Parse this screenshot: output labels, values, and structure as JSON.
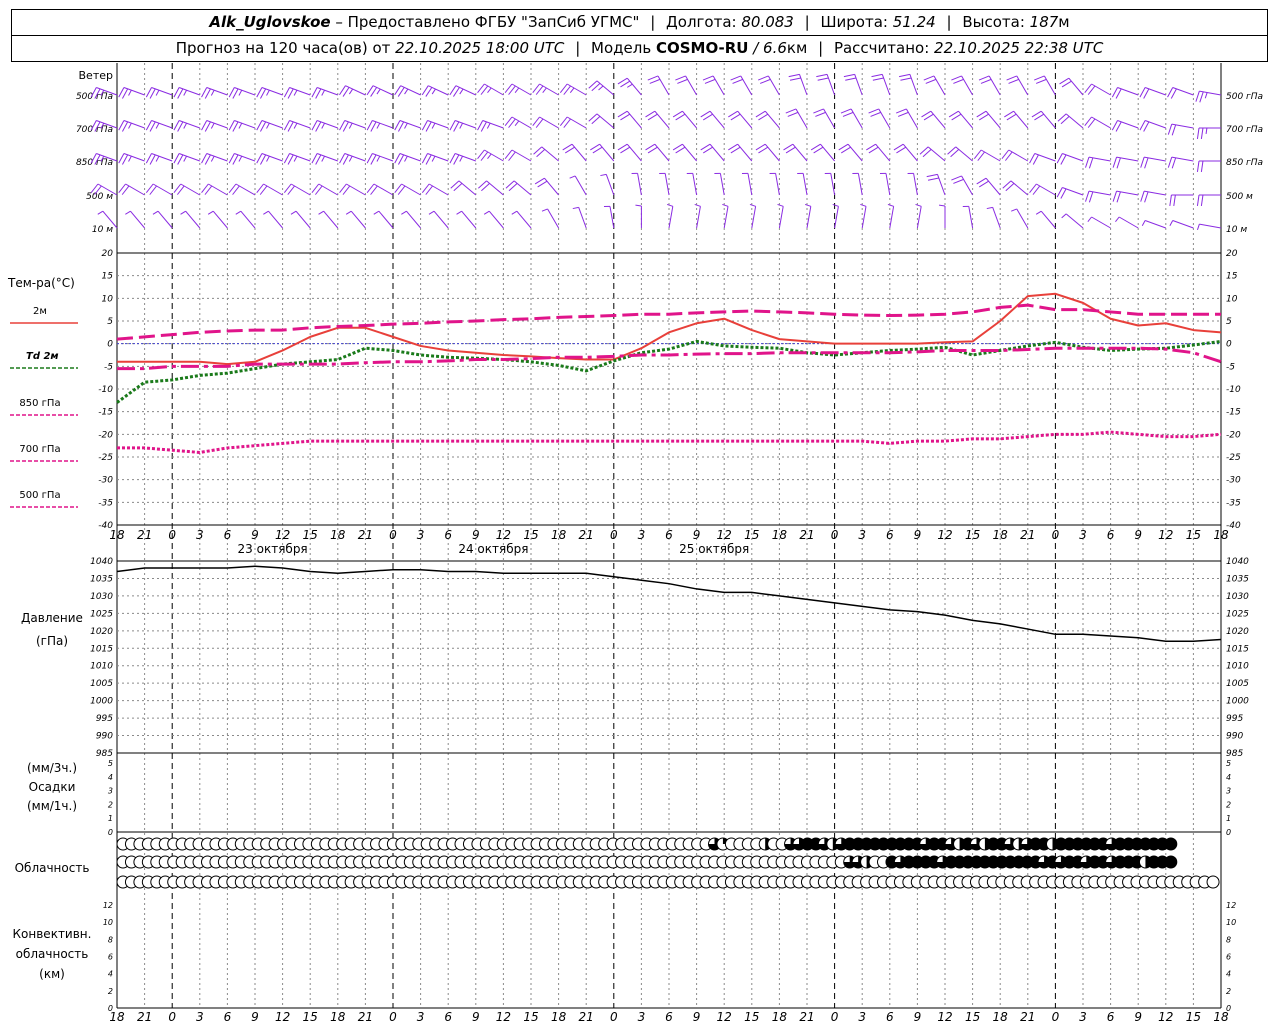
{
  "header": {
    "station": "Alk_Uglovskoe",
    "provider": "– Предоставлено ФГБУ \"ЗапСиб УГМС\"",
    "lon_label": "Долгота:",
    "lon_value": "80.083",
    "lat_label": "Широта:",
    "lat_value": "51.24",
    "alt_label": "Высота:",
    "alt_value": "187",
    "alt_unit": "м",
    "forecast_label": "Прогноз на 120 часа(ов) от",
    "forecast_start": "22.10.2025 18:00 UTC",
    "model_label": "Модель",
    "model_name": "COSMO-RU",
    "model_res": "/ 6.6",
    "model_unit": "км",
    "calc_label": "Рассчитано:",
    "calc_time": "22.10.2025 22:38 UTC"
  },
  "labels": {
    "wind": "Ветер",
    "wind_levels": [
      "500 гПа",
      "700 гПа",
      "850 гПа",
      "500 м",
      "10 м"
    ],
    "temp_title": "Тем-ра(°C)",
    "legend": [
      "2м",
      "Td 2м",
      "850 гПа",
      "700 гПа",
      "500 гПа"
    ],
    "pressure": [
      "Давление",
      "(гПа)"
    ],
    "precip": [
      "(мм/3ч.)",
      "Осадки",
      "(мм/1ч.)"
    ],
    "cloud": "Облачность",
    "conv": [
      "Конвективн.",
      "облачность",
      "(км)"
    ],
    "days": [
      "23 октября",
      "24 октября",
      "25 октября"
    ]
  },
  "colors": {
    "t2m": "#e8403a",
    "td2m": "#1a7a1a",
    "t850": "#e0148a",
    "t700": "#e0148a",
    "t500": "#e0148a",
    "wind": "#8a2be2",
    "pressure": "#000000",
    "zero_line": "#4040d0"
  },
  "chart_data": [
    {
      "type": "line",
      "title": "Тем-ра(°C)",
      "x_hours": [
        0,
        3,
        6,
        9,
        12,
        15,
        18,
        21,
        24,
        27,
        30,
        33,
        36,
        39,
        42,
        45,
        48,
        51,
        54,
        57,
        60,
        63,
        66,
        69,
        72,
        75,
        78,
        81,
        84,
        87,
        90,
        93,
        96,
        99,
        102,
        105,
        108,
        111,
        114,
        117,
        120
      ],
      "x_tick_labels": [
        "18",
        "21",
        "0",
        "3",
        "6",
        "9",
        "12",
        "15",
        "18",
        "21",
        "0",
        "3",
        "6",
        "9",
        "12",
        "15",
        "18",
        "21",
        "0",
        "3",
        "6",
        "9",
        "12",
        "15",
        "18",
        "21",
        "0",
        "3",
        "6",
        "9",
        "12",
        "15",
        "18",
        "21",
        "0",
        "3",
        "6",
        "9",
        "12",
        "15",
        "18",
        "21",
        "0"
      ],
      "ylim": [
        -40,
        20
      ],
      "yticks": [
        20,
        15,
        10,
        5,
        0,
        -5,
        -10,
        -15,
        -20,
        -25,
        -30,
        -35,
        -40
      ],
      "series": [
        {
          "name": "2м",
          "style": "solid",
          "values": [
            -4,
            -4,
            -4,
            -4,
            -4.5,
            -4,
            -1.5,
            1.5,
            3.5,
            3.5,
            1.5,
            -0.5,
            -1.5,
            -2,
            -2.5,
            -2.8,
            -3.2,
            -3.5,
            -3.5,
            -1,
            2.5,
            4.5,
            5.5,
            3,
            1,
            0.5,
            0,
            0,
            0,
            0,
            0.3,
            0.5,
            5,
            10.5,
            11,
            9,
            5.5,
            4,
            4.5,
            3,
            2.5
          ]
        },
        {
          "name": "Td 2м",
          "style": "dotted",
          "values": [
            -13,
            -8.5,
            -8,
            -7,
            -6.5,
            -5.5,
            -4.5,
            -4,
            -3.5,
            -1,
            -1.5,
            -2.5,
            -3,
            -3.2,
            -3.5,
            -4,
            -4.8,
            -6,
            -3.8,
            -2,
            -1.2,
            0.5,
            -0.5,
            -0.8,
            -1,
            -2,
            -2.5,
            -2,
            -1.5,
            -1.2,
            -0.8,
            -2.5,
            -1.5,
            -0.5,
            0.3,
            -0.8,
            -1.5,
            -1.2,
            -1,
            -0.3,
            0.5
          ]
        },
        {
          "name": "850 гПа",
          "style": "dashed",
          "values": [
            1,
            1.5,
            2,
            2.5,
            2.8,
            3,
            3,
            3.5,
            3.8,
            4,
            4.3,
            4.5,
            4.8,
            5,
            5.3,
            5.5,
            5.8,
            6,
            6.2,
            6.5,
            6.5,
            6.8,
            7,
            7.2,
            7,
            6.8,
            6.5,
            6.3,
            6.2,
            6.3,
            6.5,
            7,
            8,
            8.5,
            7.5,
            7.5,
            7,
            6.5,
            6.5,
            6.5,
            6.5
          ]
        },
        {
          "name": "700 гПа",
          "style": "dashdot",
          "values": [
            -5.5,
            -5.5,
            -5,
            -5,
            -5,
            -4.5,
            -4.5,
            -4.5,
            -4.5,
            -4.2,
            -4,
            -4,
            -3.8,
            -3.5,
            -3.5,
            -3.3,
            -3,
            -3,
            -2.8,
            -2.5,
            -2.5,
            -2.3,
            -2.2,
            -2.2,
            -2,
            -2,
            -2,
            -2,
            -2,
            -1.8,
            -1.5,
            -1.5,
            -1.5,
            -1.3,
            -1,
            -1,
            -1,
            -1,
            -1.2,
            -2,
            -4
          ]
        },
        {
          "name": "500 гПа",
          "style": "dotted",
          "values": [
            -23,
            -23,
            -23.5,
            -24,
            -23,
            -22.5,
            -22,
            -21.5,
            -21.5,
            -21.5,
            -21.5,
            -21.5,
            -21.5,
            -21.5,
            -21.5,
            -21.5,
            -21.5,
            -21.5,
            -21.5,
            -21.5,
            -21.5,
            -21.5,
            -21.5,
            -21.5,
            -21.5,
            -21.5,
            -21.5,
            -21.5,
            -22,
            -21.5,
            -21.5,
            -21,
            -21,
            -20.5,
            -20,
            -20,
            -19.5,
            -20,
            -20.5,
            -20.5,
            -20
          ]
        }
      ]
    },
    {
      "type": "line",
      "title": "Давление (гПа)",
      "ylim": [
        985,
        1040
      ],
      "yticks": [
        1040,
        1035,
        1030,
        1025,
        1020,
        1015,
        1010,
        1005,
        1000,
        995,
        990,
        985
      ],
      "series": [
        {
          "name": "Давление",
          "style": "solid",
          "values": [
            1037,
            1038,
            1038,
            1038,
            1038,
            1038.5,
            1038,
            1037,
            1036.5,
            1037,
            1037.5,
            1037.5,
            1037,
            1037,
            1036.5,
            1036.5,
            1036.5,
            1036.5,
            1035.5,
            1034.5,
            1033.5,
            1032,
            1031,
            1031,
            1030,
            1029,
            1028,
            1027,
            1026,
            1025.5,
            1024.5,
            1023,
            1022,
            1020.5,
            1019,
            1019,
            1018.5,
            1018,
            1017,
            1017,
            1017.5
          ]
        }
      ]
    },
    {
      "type": "bar",
      "title": "Осадки",
      "ylim": [
        0,
        5
      ],
      "yticks": [
        5,
        4,
        3,
        2,
        1,
        0
      ],
      "values": []
    },
    {
      "type": "bar",
      "title": "Конвективн. облачность (км)",
      "ylim": [
        0,
        12
      ],
      "yticks": [
        12,
        10,
        8,
        6,
        4,
        2,
        0
      ],
      "values": []
    }
  ],
  "clouds": {
    "rows": [
      [
        0,
        0,
        0,
        0,
        0,
        0,
        0,
        0,
        0,
        0,
        0,
        0,
        0,
        0,
        0,
        0,
        0,
        0,
        0,
        0,
        0,
        0,
        0,
        0,
        0,
        0,
        0,
        0,
        0,
        0,
        0,
        0,
        0,
        0,
        0,
        0,
        0,
        0,
        0,
        0,
        0,
        0,
        0,
        0,
        0,
        0,
        0,
        0,
        0,
        0,
        0,
        0,
        0,
        0,
        0,
        0,
        0,
        0,
        0,
        0,
        0,
        0,
        0,
        0,
        0,
        0,
        0,
        0,
        0,
        0,
        3,
        1,
        0,
        0,
        0,
        0,
        2,
        0,
        0,
        3,
        3,
        4,
        4,
        3,
        2,
        3,
        4,
        4,
        4,
        4,
        4,
        4,
        4,
        4,
        4,
        3,
        4,
        4,
        3,
        2,
        4,
        3,
        2,
        4,
        4,
        3,
        2,
        3,
        4,
        4,
        2,
        4,
        4,
        4,
        4,
        4,
        4,
        3,
        4,
        4,
        4,
        4,
        4,
        4,
        4
      ],
      [
        0,
        0,
        0,
        0,
        0,
        0,
        0,
        0,
        0,
        0,
        0,
        0,
        0,
        0,
        0,
        0,
        0,
        0,
        0,
        0,
        0,
        0,
        0,
        0,
        0,
        0,
        0,
        0,
        0,
        0,
        0,
        0,
        0,
        0,
        0,
        0,
        0,
        0,
        0,
        0,
        0,
        0,
        0,
        0,
        0,
        0,
        0,
        0,
        0,
        0,
        0,
        0,
        0,
        0,
        0,
        0,
        0,
        0,
        0,
        0,
        0,
        0,
        0,
        0,
        0,
        0,
        0,
        0,
        0,
        0,
        0,
        0,
        0,
        0,
        0,
        0,
        0,
        0,
        0,
        0,
        0,
        0,
        0,
        0,
        0,
        0,
        3,
        3,
        2,
        0,
        0,
        4,
        3,
        4,
        4,
        4,
        4,
        3,
        4,
        4,
        4,
        4,
        4,
        4,
        4,
        4,
        4,
        4,
        4,
        3,
        4,
        3,
        4,
        4,
        3,
        4,
        4,
        3,
        4,
        4,
        4,
        2,
        4,
        4,
        4
      ],
      [
        0,
        0,
        0,
        0,
        0,
        0,
        0,
        0,
        0,
        0,
        0,
        0,
        0,
        0,
        0,
        0,
        0,
        0,
        0,
        0,
        0,
        0,
        0,
        0,
        0,
        0,
        0,
        0,
        0,
        0,
        0,
        0,
        0,
        0,
        0,
        0,
        0,
        0,
        0,
        0,
        0,
        0,
        0,
        0,
        0,
        0,
        0,
        0,
        0,
        0,
        0,
        0,
        0,
        0,
        0,
        0,
        0,
        0,
        0,
        0,
        0,
        0,
        0,
        0,
        0,
        0,
        0,
        0,
        0,
        0,
        0,
        0,
        0,
        0,
        0,
        0,
        0,
        0,
        0,
        0,
        0,
        0,
        0,
        0,
        0,
        0,
        0,
        0,
        0,
        0,
        0,
        0,
        0,
        0,
        0,
        0,
        0,
        0,
        0,
        0,
        0,
        0,
        0,
        0,
        0,
        0,
        0,
        0,
        0,
        0,
        0,
        0,
        0,
        0,
        0,
        0,
        0,
        0,
        0,
        0,
        0,
        0,
        0,
        0,
        0,
        0,
        0,
        0,
        0,
        0,
        0
      ]
    ]
  },
  "wind_barbs": {
    "rows": [
      {
        "level": "500 гПа",
        "speed": [
          15,
          15,
          15,
          15,
          15,
          15,
          15,
          15,
          15,
          15,
          15,
          15,
          15,
          15,
          15,
          15,
          15,
          15,
          15,
          15,
          10,
          10,
          10,
          10,
          10,
          10,
          10,
          10,
          10,
          10,
          10,
          10,
          10,
          10,
          10,
          10,
          10,
          10,
          10,
          10,
          15
        ],
        "dir": [
          290,
          290,
          290,
          290,
          290,
          290,
          290,
          290,
          290,
          295,
          295,
          295,
          295,
          295,
          300,
          300,
          300,
          300,
          310,
          320,
          330,
          330,
          330,
          330,
          330,
          340,
          340,
          340,
          340,
          340,
          330,
          330,
          330,
          330,
          330,
          320,
          300,
          290,
          290,
          290,
          280
        ]
      },
      {
        "level": "700 гПа",
        "speed": [
          15,
          15,
          15,
          15,
          15,
          15,
          15,
          15,
          15,
          15,
          15,
          15,
          15,
          15,
          15,
          15,
          10,
          10,
          10,
          10,
          10,
          10,
          10,
          10,
          10,
          10,
          10,
          10,
          10,
          10,
          10,
          10,
          10,
          10,
          10,
          10,
          10,
          10,
          10,
          10,
          15
        ],
        "dir": [
          290,
          290,
          290,
          290,
          290,
          290,
          290,
          290,
          290,
          290,
          290,
          290,
          290,
          290,
          290,
          300,
          300,
          300,
          310,
          320,
          320,
          320,
          320,
          320,
          320,
          330,
          330,
          330,
          330,
          330,
          320,
          320,
          320,
          320,
          320,
          310,
          300,
          290,
          290,
          280,
          270
        ]
      },
      {
        "level": "850 гПа",
        "speed": [
          15,
          15,
          15,
          15,
          15,
          15,
          15,
          15,
          15,
          15,
          15,
          15,
          15,
          15,
          15,
          10,
          10,
          10,
          10,
          10,
          10,
          10,
          10,
          10,
          10,
          10,
          10,
          10,
          10,
          10,
          10,
          10,
          10,
          10,
          10,
          10,
          10,
          10,
          10,
          10,
          10
        ],
        "dir": [
          290,
          290,
          290,
          290,
          290,
          290,
          290,
          290,
          290,
          290,
          290,
          290,
          290,
          290,
          300,
          300,
          310,
          320,
          320,
          320,
          320,
          320,
          320,
          320,
          320,
          320,
          320,
          320,
          320,
          320,
          310,
          310,
          300,
          300,
          290,
          290,
          280,
          280,
          280,
          280,
          270
        ]
      },
      {
        "level": "500 м",
        "speed": [
          10,
          10,
          10,
          10,
          10,
          10,
          10,
          10,
          10,
          10,
          10,
          10,
          10,
          10,
          10,
          10,
          10,
          5,
          5,
          5,
          5,
          5,
          5,
          5,
          5,
          5,
          5,
          5,
          5,
          5,
          10,
          10,
          10,
          10,
          10,
          10,
          10,
          10,
          10,
          10,
          10
        ],
        "dir": [
          300,
          300,
          300,
          300,
          300,
          300,
          300,
          300,
          300,
          300,
          300,
          300,
          300,
          310,
          310,
          310,
          320,
          330,
          340,
          350,
          350,
          350,
          350,
          350,
          350,
          350,
          350,
          350,
          350,
          350,
          340,
          330,
          320,
          310,
          300,
          290,
          280,
          280,
          280,
          270,
          270
        ]
      },
      {
        "level": "10 м",
        "speed": [
          5,
          5,
          5,
          5,
          5,
          5,
          5,
          5,
          5,
          5,
          5,
          5,
          5,
          5,
          5,
          5,
          5,
          5,
          5,
          5,
          5,
          5,
          5,
          5,
          5,
          5,
          5,
          5,
          5,
          5,
          5,
          5,
          5,
          5,
          5,
          5,
          5,
          5,
          5,
          5,
          5
        ],
        "dir": [
          320,
          320,
          320,
          320,
          320,
          320,
          320,
          320,
          320,
          320,
          320,
          320,
          320,
          320,
          320,
          320,
          330,
          340,
          350,
          0,
          10,
          10,
          10,
          10,
          10,
          10,
          10,
          10,
          10,
          10,
          0,
          350,
          340,
          330,
          320,
          310,
          300,
          300,
          290,
          290,
          280
        ]
      }
    ]
  }
}
